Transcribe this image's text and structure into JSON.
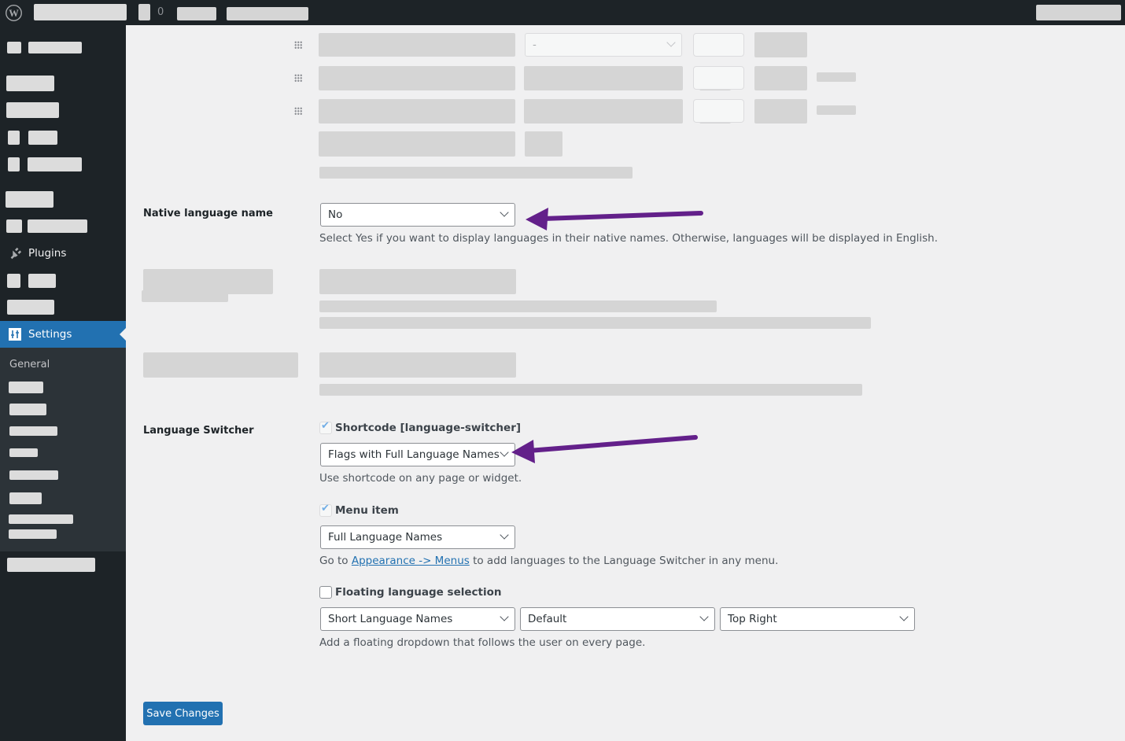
{
  "admin_bar": {
    "comment_count": "0",
    "logo_icon": "wordpress-logo-icon"
  },
  "sidebar": {
    "plugins_label": "Plugins",
    "plugins_icon": "plug-icon",
    "settings_label": "Settings",
    "settings_icon": "sliders-icon",
    "submenu": {
      "general_label": "General"
    }
  },
  "language_rows": {
    "empty_select_value": "-"
  },
  "native_language": {
    "label": "Native language name",
    "value": "No",
    "description": "Select Yes if you want to display languages in their native names. Otherwise, languages will be displayed in English."
  },
  "language_switcher": {
    "label": "Language Switcher",
    "shortcode": {
      "label": "Shortcode [language-switcher]",
      "checked": true,
      "value": "Flags with Full Language Names",
      "description": "Use shortcode on any page or widget."
    },
    "menu_item": {
      "label": "Menu item",
      "checked": true,
      "value": "Full Language Names",
      "description_prefix": "Go to ",
      "link_text": "Appearance -> Menus",
      "description_suffix": " to add languages to the Language Switcher in any menu."
    },
    "floating": {
      "label": "Floating language selection",
      "checked": false,
      "names_value": "Short Language Names",
      "theme_value": "Default",
      "position_value": "Top Right",
      "description": "Add a floating dropdown that follows the user on every page."
    }
  },
  "save_button": "Save Changes",
  "colors": {
    "accent": "#2271b1",
    "sidebar": "#1d2327",
    "annotation_arrow": "#63208a"
  }
}
